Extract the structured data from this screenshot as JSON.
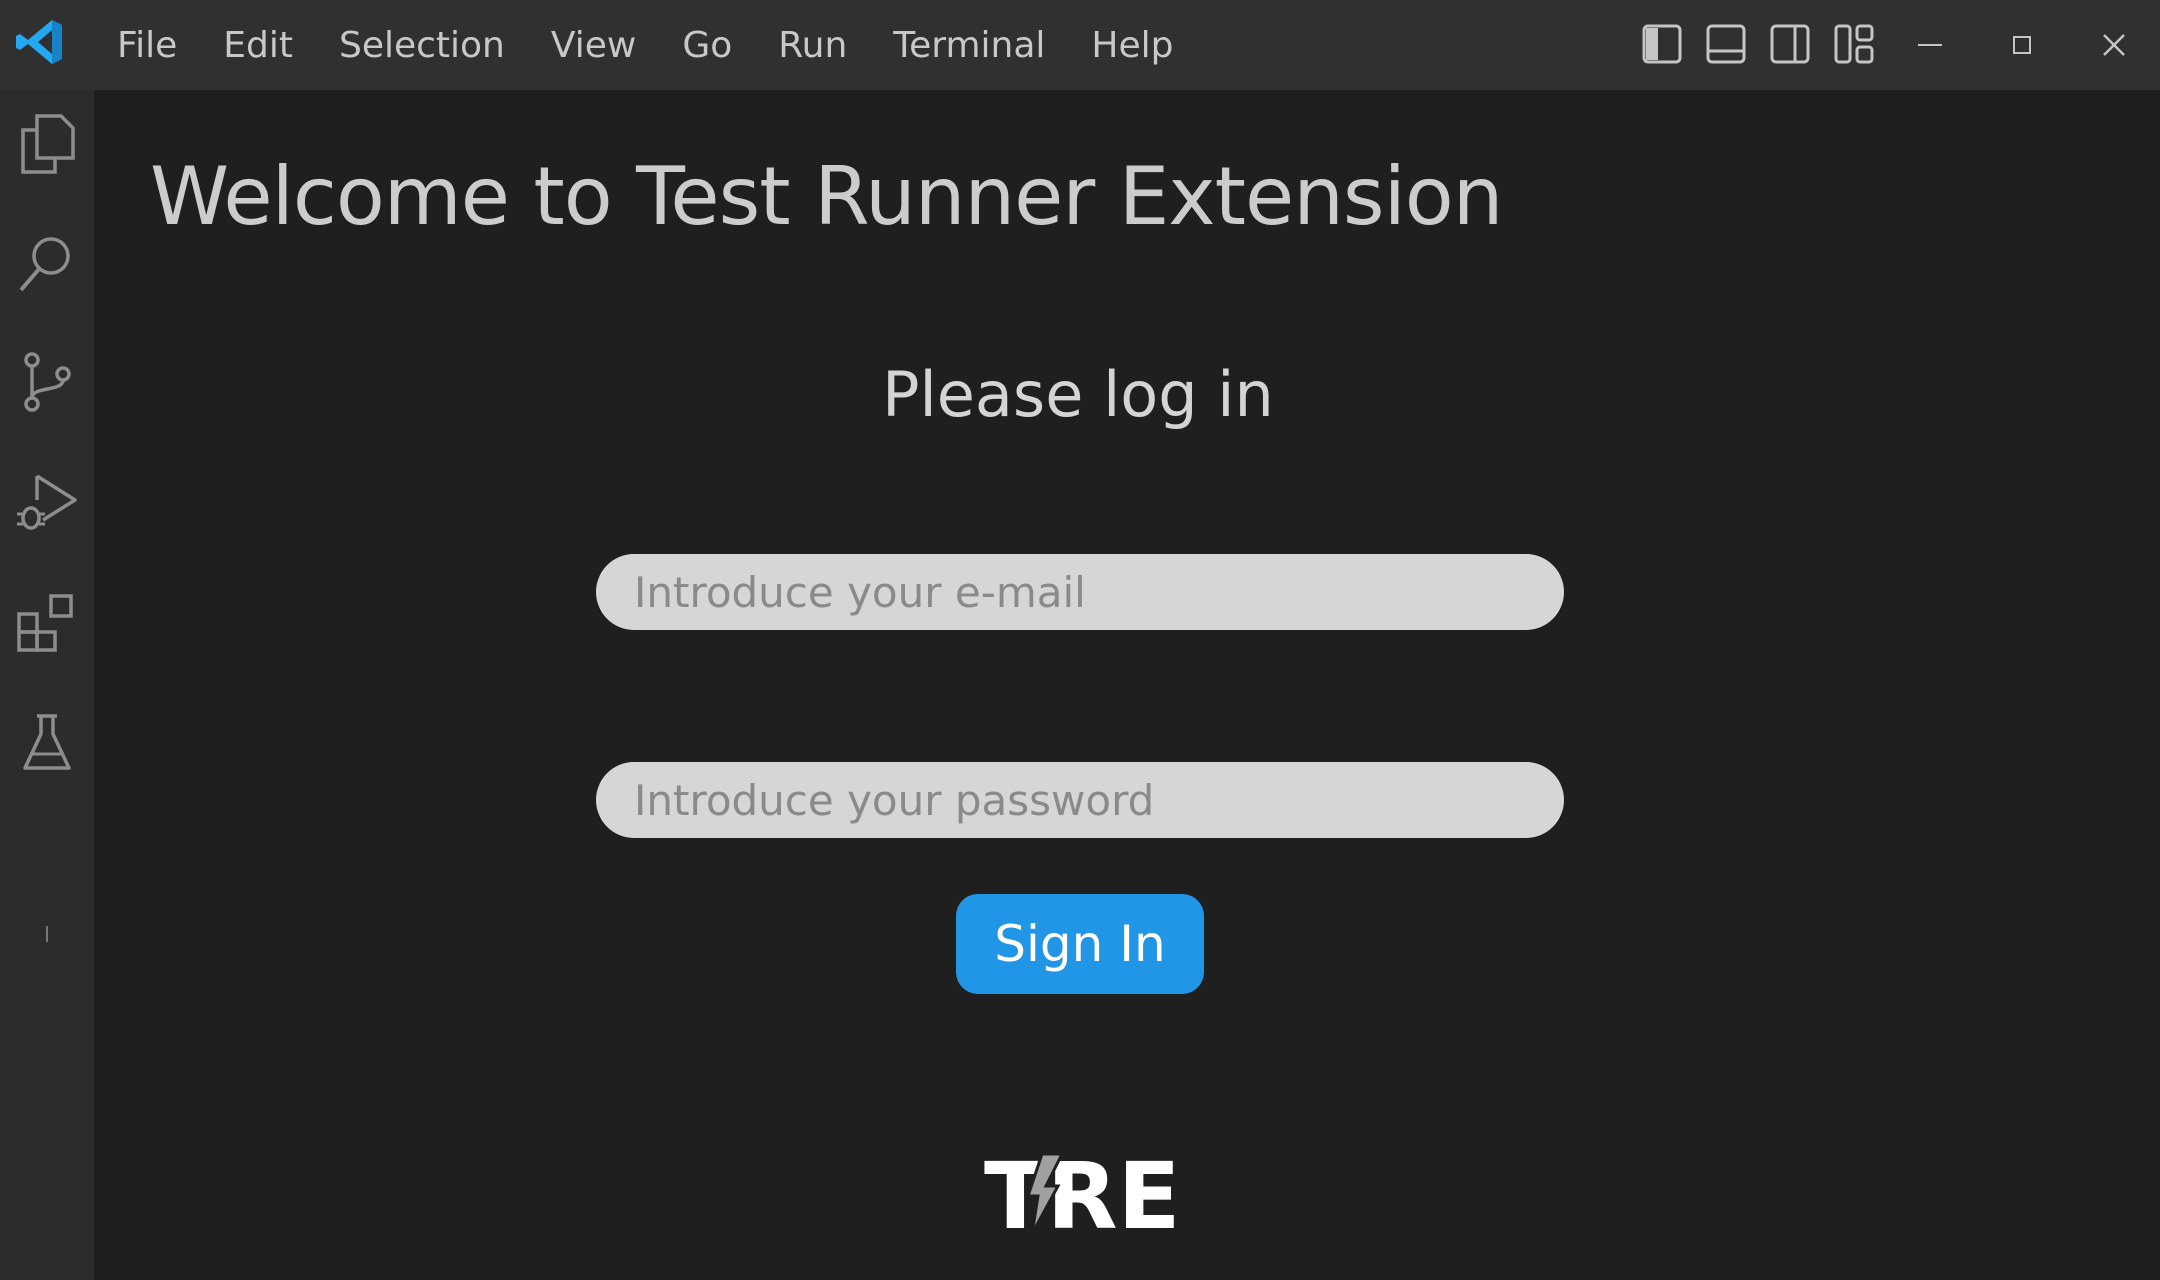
{
  "titlebar": {
    "menu": [
      "File",
      "Edit",
      "Selection",
      "View",
      "Go",
      "Run",
      "Terminal",
      "Help"
    ],
    "layout_icons": [
      "toggle-primary-sidebar-icon",
      "toggle-panel-icon",
      "toggle-secondary-sidebar-icon",
      "customize-layout-icon"
    ],
    "window_icons": [
      "minimize-icon",
      "maximize-icon",
      "close-icon"
    ]
  },
  "activitybar": {
    "icons": [
      "explorer-icon",
      "search-icon",
      "source-control-icon",
      "run-debug-icon",
      "extensions-icon",
      "testing-icon"
    ]
  },
  "main": {
    "welcome_title": "Welcome to Test Runner Extension",
    "login_title": "Please log in",
    "email_placeholder": "Introduce your e-mail",
    "password_placeholder": "Introduce your password",
    "signin_label": "Sign In",
    "logo_text": "TRE"
  },
  "colors": {
    "accent_button": "#2196e6",
    "vscode_blue": "#23a8f2",
    "background": "#1f1f1f",
    "titlebar": "#303030",
    "activitybar": "#2c2c2c"
  }
}
